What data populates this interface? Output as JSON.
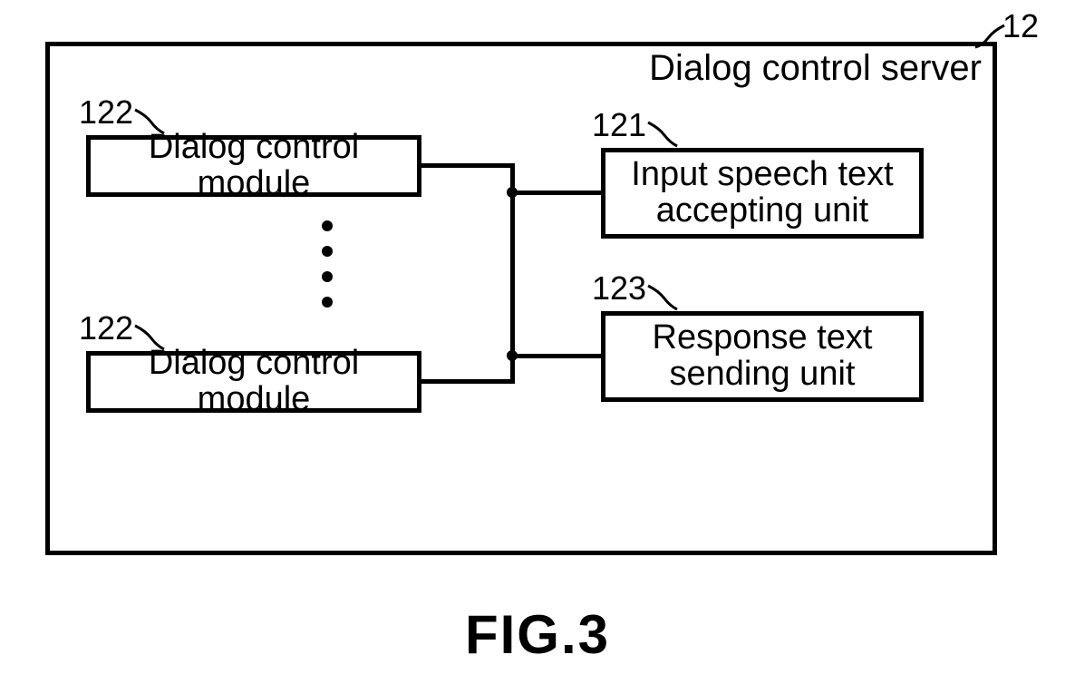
{
  "outer_ref": "12",
  "server_title": "Dialog control server",
  "blocks": {
    "module_top": {
      "ref": "122",
      "label": "Dialog control module"
    },
    "module_bottom": {
      "ref": "122",
      "label": "Dialog control module"
    },
    "input_unit": {
      "ref": "121",
      "label": "Input speech text\naccepting unit"
    },
    "response_unit": {
      "ref": "123",
      "label": "Response text\nsending unit"
    }
  },
  "caption": "FIG.3"
}
